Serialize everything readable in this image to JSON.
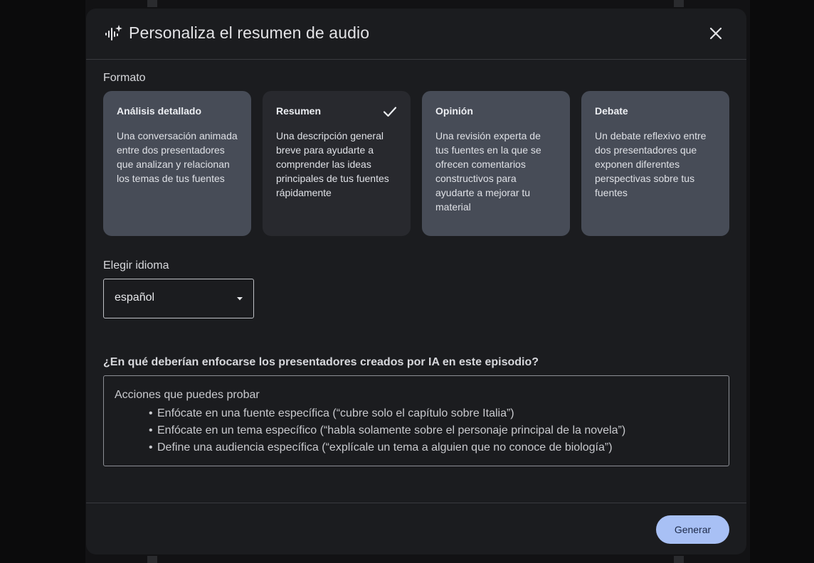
{
  "dialog": {
    "title": "Personaliza el resumen de audio",
    "title_icon": "audio-sparkle-icon",
    "close_icon": "close-icon"
  },
  "format": {
    "label": "Formato",
    "options": [
      {
        "title": "Análisis detallado",
        "description": "Una conversación animada entre dos presentadores que analizan y relacionan los temas de tus fuentes",
        "selected": false
      },
      {
        "title": "Resumen",
        "description": "Una descripción general breve para ayudarte a comprender las ideas principales de tus fuentes rápidamente",
        "selected": true
      },
      {
        "title": "Opinión",
        "description": "Una revisión experta de tus fuentes en la que se ofrecen comentarios constructivos para ayudarte a mejorar tu material",
        "selected": false
      },
      {
        "title": "Debate",
        "description": "Un debate reflexivo entre dos presentadores que exponen diferentes perspectivas sobre tus fuentes",
        "selected": false
      }
    ]
  },
  "language": {
    "label": "Elegir idioma",
    "value": "español"
  },
  "focus": {
    "question": "¿En qué deberían enfocarse los presentadores creados por IA en este episodio?",
    "hint_title": "Acciones que puedes probar",
    "hints": [
      "Enfócate en una fuente específica (“cubre solo el capítulo sobre Italia”)",
      "Enfócate en un tema específico (“habla solamente sobre el personaje principal de la novela”)",
      "Define una audiencia específica (“explícale un tema a alguien que no conoce de biología”)"
    ]
  },
  "actions": {
    "generate_label": "Generar"
  },
  "colors": {
    "card_unselected": "#474c57",
    "card_selected": "#28292e",
    "primary_button": "#a8c0f5"
  }
}
